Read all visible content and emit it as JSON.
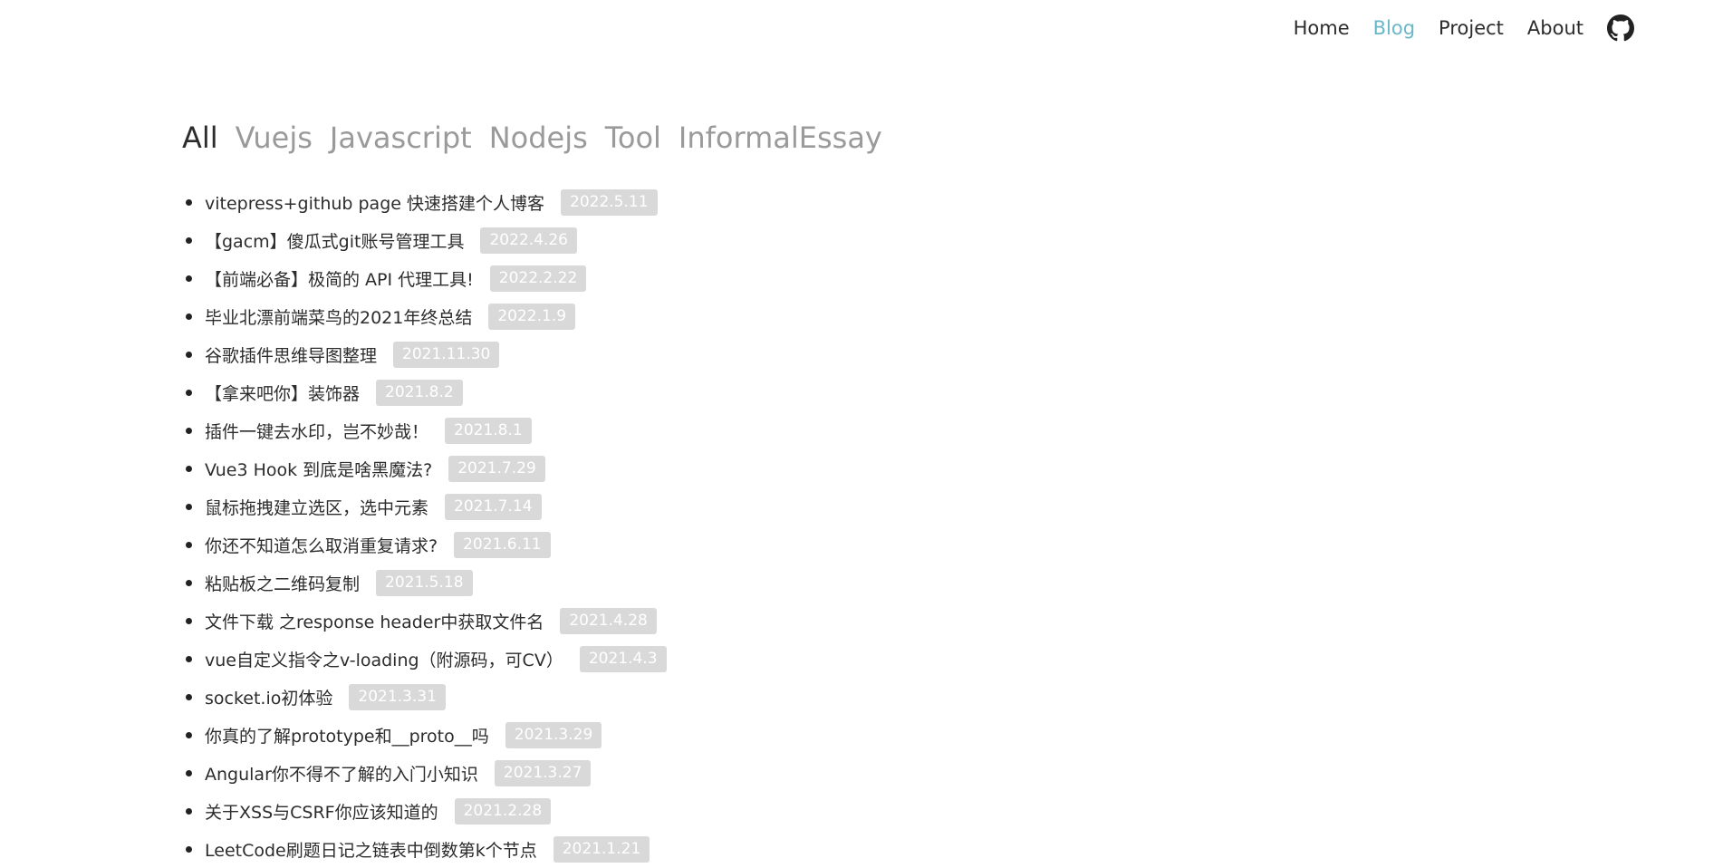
{
  "nav": {
    "home": "Home",
    "blog": "Blog",
    "project": "Project",
    "about": "About",
    "github_icon": "github-icon"
  },
  "colors": {
    "active_nav": "#6ab7c7",
    "date_badge_bg": "#d9d9d9",
    "category_inactive": "#9a9a9a"
  },
  "categories": [
    {
      "label": "All"
    },
    {
      "label": "Vuejs"
    },
    {
      "label": "Javascript"
    },
    {
      "label": "Nodejs"
    },
    {
      "label": "Tool"
    },
    {
      "label": "InformalEssay"
    }
  ],
  "active_category": "All",
  "posts": [
    {
      "title": "vitepress+github page 快速搭建个人博客",
      "date": "2022.5.11"
    },
    {
      "title": "【gacm】傻瓜式git账号管理工具",
      "date": "2022.4.26"
    },
    {
      "title": "【前端必备】极简的 API 代理工具!",
      "date": "2022.2.22"
    },
    {
      "title": "毕业北漂前端菜鸟的2021年终总结",
      "date": "2022.1.9"
    },
    {
      "title": "谷歌插件思维导图整理",
      "date": "2021.11.30"
    },
    {
      "title": "【拿来吧你】装饰器",
      "date": "2021.8.2"
    },
    {
      "title": "插件一键去水印，岂不妙哉！",
      "date": "2021.8.1"
    },
    {
      "title": "Vue3 Hook 到底是啥黑魔法?",
      "date": "2021.7.29"
    },
    {
      "title": "鼠标拖拽建立选区，选中元素",
      "date": "2021.7.14"
    },
    {
      "title": "你还不知道怎么取消重复请求?",
      "date": "2021.6.11"
    },
    {
      "title": "粘贴板之二维码复制",
      "date": "2021.5.18"
    },
    {
      "title": "文件下载 之response header中获取文件名",
      "date": "2021.4.28"
    },
    {
      "title": "vue自定义指令之v-loading（附源码，可CV）",
      "date": "2021.4.3"
    },
    {
      "title": "socket.io初体验",
      "date": "2021.3.31"
    },
    {
      "title": "你真的了解prototype和__proto__吗",
      "date": "2021.3.29"
    },
    {
      "title": "Angular你不得不了解的入门小知识",
      "date": "2021.3.27"
    },
    {
      "title": "关于XSS与CSRF你应该知道的",
      "date": "2021.2.28"
    },
    {
      "title": "LeetCode刷题日记之链表中倒数第k个节点",
      "date": "2021.1.21"
    }
  ]
}
